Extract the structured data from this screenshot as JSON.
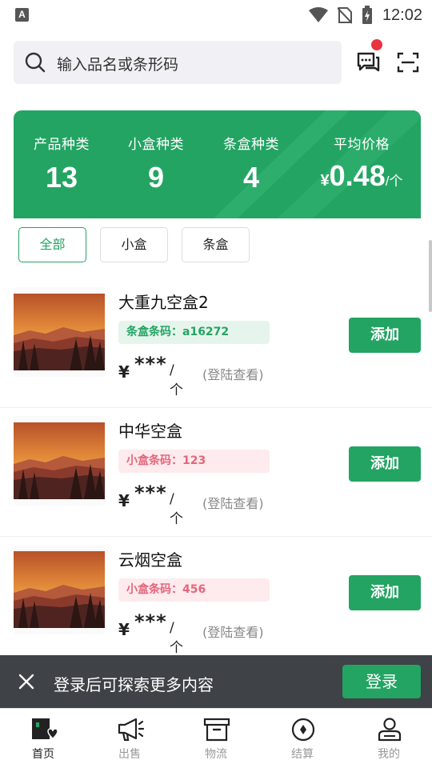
{
  "status_bar": {
    "time": "12:02",
    "notification_glyph": "A"
  },
  "search": {
    "placeholder": "输入品名或条形码"
  },
  "stats": {
    "items": [
      {
        "label": "产品种类",
        "value": "13"
      },
      {
        "label": "小盒种类",
        "value": "9"
      },
      {
        "label": "条盒种类",
        "value": "4"
      }
    ],
    "avg_price": {
      "label": "平均价格",
      "currency": "¥",
      "value": "0.48",
      "unit": "/个"
    }
  },
  "filters": [
    {
      "label": "全部",
      "active": true
    },
    {
      "label": "小盒",
      "active": false
    },
    {
      "label": "条盒",
      "active": false
    }
  ],
  "products": [
    {
      "title": "大重九空盒2",
      "code_label": "条盒条码：a16272",
      "code_type": "green",
      "currency": "¥",
      "price_mask": "***",
      "unit": "/个",
      "hint": "(登陆查看)",
      "add_label": "添加"
    },
    {
      "title": "中华空盒",
      "code_label": "小盒条码：123",
      "code_type": "pink",
      "currency": "¥",
      "price_mask": "***",
      "unit": "/个",
      "hint": "(登陆查看)",
      "add_label": "添加"
    },
    {
      "title": "云烟空盒",
      "code_label": "小盒条码：456",
      "code_type": "pink",
      "currency": "¥",
      "price_mask": "***",
      "unit": "/个",
      "hint": "(登陆查看)",
      "add_label": "添加"
    }
  ],
  "login_banner": {
    "text": "登录后可探索更多内容",
    "button": "登录"
  },
  "tabbar": [
    {
      "label": "首页",
      "icon": "home-shop-icon",
      "active": true
    },
    {
      "label": "出售",
      "icon": "megaphone-icon",
      "active": false
    },
    {
      "label": "物流",
      "icon": "archive-box-icon",
      "active": false
    },
    {
      "label": "结算",
      "icon": "coin-icon",
      "active": false
    },
    {
      "label": "我的",
      "icon": "user-icon",
      "active": false
    }
  ],
  "colors": {
    "accent": "#23a463",
    "pink": "#e5667b",
    "banner": "#3f4246",
    "badge": "#e8343e"
  }
}
